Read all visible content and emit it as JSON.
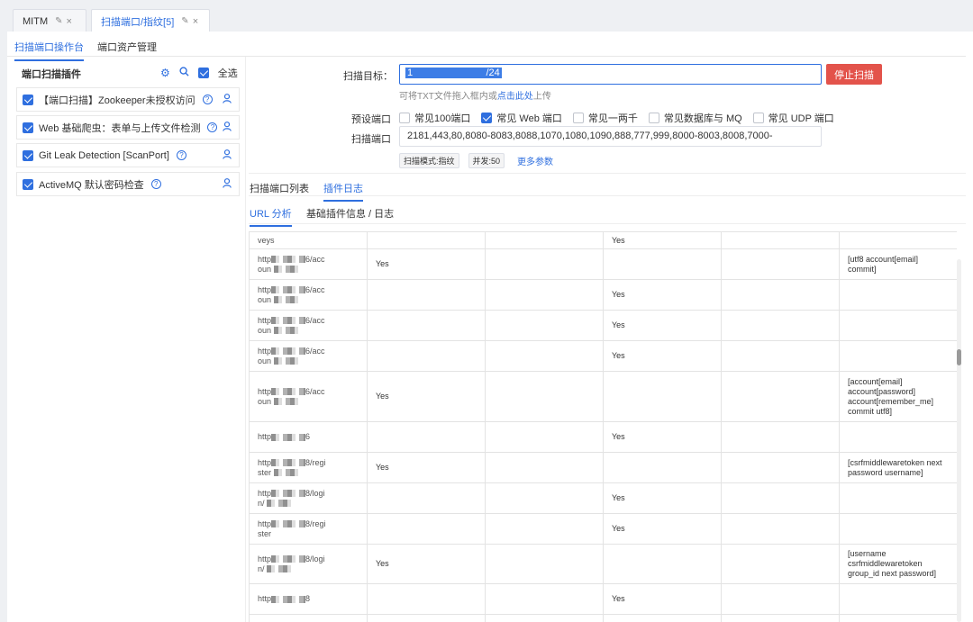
{
  "top_tabs": [
    {
      "label": "MITM",
      "active": false
    },
    {
      "label": "扫描端口/指纹[5]",
      "active": true
    }
  ],
  "sub_tabs": [
    {
      "label": "扫描端口操作台",
      "active": true
    },
    {
      "label": "端口资产管理",
      "active": false
    }
  ],
  "plugins_panel": {
    "title": "端口扫描插件",
    "select_all_label": "全选",
    "select_all_checked": true,
    "items": [
      {
        "label": "【端口扫描】Zookeeper未授权访问",
        "checked": true
      },
      {
        "label": "Web 基础爬虫：表单与上传文件检测",
        "checked": true
      },
      {
        "label": "Git Leak Detection [ScanPort]",
        "checked": true
      },
      {
        "label": "ActiveMQ 默认密码检查",
        "checked": true
      }
    ]
  },
  "form": {
    "target_label": "扫描目标：",
    "target_value_start": "1",
    "target_value_end": "/24",
    "stop_button": "停止扫描",
    "hint_text": "可将TXT文件拖入框内或",
    "hint_link": "点击此处",
    "hint_suffix": "上传",
    "preset_label": "预设端口",
    "presets": [
      {
        "label": "常见100端口",
        "checked": false
      },
      {
        "label": "常见 Web 端口",
        "checked": true
      },
      {
        "label": "常见一两千",
        "checked": false
      },
      {
        "label": "常见数据库与 MQ",
        "checked": false
      },
      {
        "label": "常见 UDP 端口",
        "checked": false
      }
    ],
    "ports_label": "扫描端口",
    "ports_value": "2181,443,80,8080-8083,8088,1070,1080,1090,888,777,999,8000-8003,8008,7000-",
    "tag_mode": "扫描模式:指纹",
    "tag_concurrency": "并发:50",
    "more_params": "更多参数"
  },
  "result_tabs": [
    {
      "label": "扫描端口列表",
      "active": false
    },
    {
      "label": "插件日志",
      "active": true
    }
  ],
  "log_tabs": [
    {
      "label": "URL 分析",
      "active": true
    },
    {
      "label": "基础插件信息 / 日志",
      "active": false
    }
  ],
  "table_rows": [
    {
      "url_a": "",
      "url_b": "veys",
      "c1": "",
      "c3": "Yes",
      "c6": ""
    },
    {
      "url_a": "http",
      "url_b": "oun",
      "url_suffix": "6/acc",
      "c1": "Yes",
      "c3": "",
      "c6": "[utf8 account[email] commit]"
    },
    {
      "url_a": "http",
      "url_b": "oun",
      "url_suffix": "6/acc",
      "c1": "",
      "c3": "Yes",
      "c6": ""
    },
    {
      "url_a": "http",
      "url_b": "oun",
      "url_suffix": "6/acc",
      "c1": "",
      "c3": "Yes",
      "c6": ""
    },
    {
      "url_a": "http",
      "url_b": "oun",
      "url_suffix": "6/acc",
      "c1": "",
      "c3": "Yes",
      "c6": ""
    },
    {
      "url_a": "http",
      "url_b": "oun",
      "url_suffix": "6/acc",
      "c1": "Yes",
      "c3": "",
      "c6": "[account[email] account[password] account[remember_me] commit utf8]"
    },
    {
      "url_a": "http",
      "url_b": "",
      "url_suffix": "6",
      "c1": "",
      "c3": "Yes",
      "c6": ""
    },
    {
      "url_a": "http",
      "url_b": "ster",
      "url_suffix": "8/regi",
      "c1": "Yes",
      "c3": "",
      "c6": "[csrfmiddlewaretoken next password username]"
    },
    {
      "url_a": "http",
      "url_b": "n/",
      "url_suffix": "8/logi",
      "c1": "",
      "c3": "Yes",
      "c6": ""
    },
    {
      "url_a": "http",
      "url_b": "ster",
      "url_suffix": "8/regi",
      "c1": "",
      "c3": "Yes",
      "c6": ""
    },
    {
      "url_a": "http",
      "url_b": "n/",
      "url_suffix": "8/logi",
      "c1": "Yes",
      "c3": "",
      "c6": "[username csrfmiddlewaretoken group_id next password]"
    },
    {
      "url_a": "http",
      "url_b": "",
      "url_suffix": "8",
      "c1": "",
      "c3": "Yes",
      "c6": ""
    },
    {
      "url_a": "",
      "url_b": "",
      "c1": "",
      "c3": "",
      "c6": ""
    }
  ]
}
